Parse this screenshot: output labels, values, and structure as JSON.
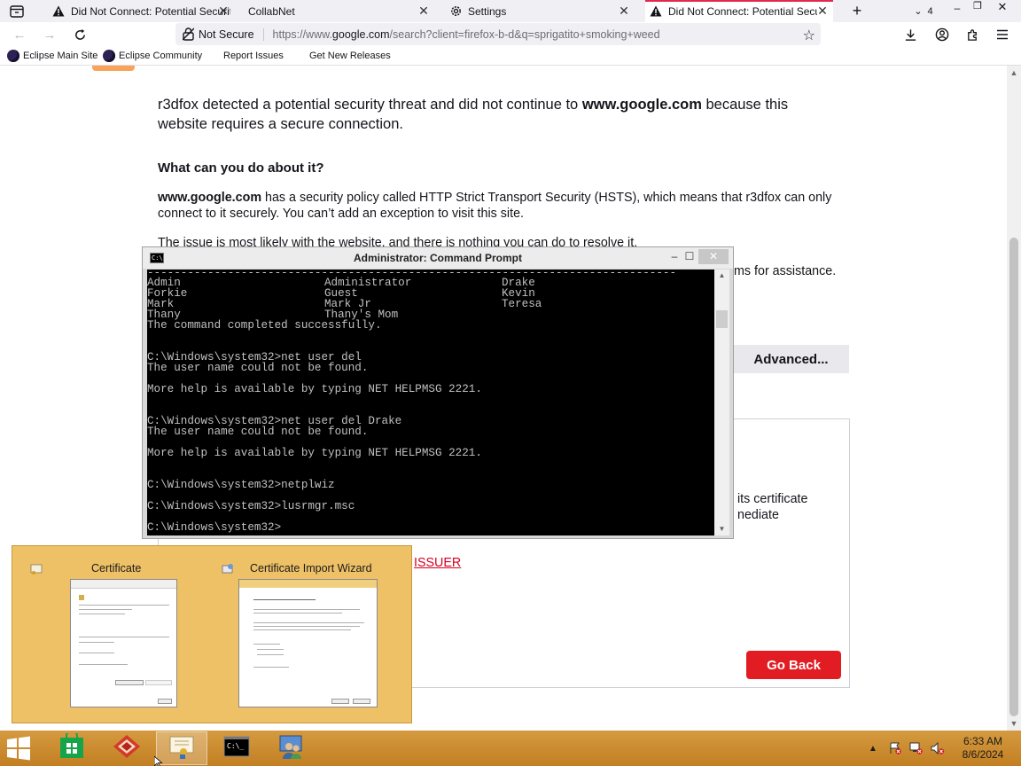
{
  "browser": {
    "tabs": [
      {
        "title": "Did Not Connect: Potential Security Issue",
        "icon": "warning-icon",
        "active": false
      },
      {
        "title": "CollabNet",
        "icon": "",
        "active": false
      },
      {
        "title": "Settings",
        "icon": "gear-icon",
        "active": false
      },
      {
        "title": "Did Not Connect: Potential Security Issue",
        "icon": "warning-icon",
        "active": true
      }
    ],
    "tab_count": "4",
    "security_label": "Not Secure",
    "url_prefix": "https://www.",
    "url_domain": "google.com",
    "url_rest": "/search?client=firefox-b-d&q=sprigatito+smoking+weed",
    "bookmarks": [
      "Eclipse Main Site",
      "Eclipse Community",
      "Report Issues",
      "Get New Releases"
    ]
  },
  "page": {
    "intro_pre": "r3dfox detected a potential security threat and did not continue to ",
    "intro_domain": "www.google.com",
    "intro_post": " because this website requires a secure connection.",
    "what_heading": "What can you do about it?",
    "hsts_domain": "www.google.com",
    "hsts_text": " has a security policy called HTTP Strict Transport Security (HSTS), which means that r3dfox can only connect to it securely. You can’t add an exception to visit this site.",
    "issue_text": "The issue is most likely with the website, and there is nothing you can do to resolve it.",
    "assist_fragment": "ms for assistance.",
    "advanced_label": "Advanced...",
    "adv_fragment_1": "its certificate",
    "adv_fragment_2": "nediate",
    "issuer_link": "ISSUER",
    "go_back_label": "Go Back"
  },
  "cmd": {
    "title": "Administrator: Command Prompt",
    "user_rows": [
      [
        "Admin",
        "Administrator",
        "Drake"
      ],
      [
        "Forkie",
        "Guest",
        "Kevin"
      ],
      [
        "Mark",
        "Mark Jr",
        "Teresa"
      ],
      [
        "Thany",
        "Thany's Mom",
        ""
      ]
    ],
    "lines": [
      "The command completed successfully.",
      "",
      "",
      "C:\\Windows\\system32>net user del",
      "The user name could not be found.",
      "",
      "More help is available by typing NET HELPMSG 2221.",
      "",
      "",
      "C:\\Windows\\system32>net user del Drake",
      "The user name could not be found.",
      "",
      "More help is available by typing NET HELPMSG 2221.",
      "",
      "",
      "C:\\Windows\\system32>netplwiz",
      "",
      "C:\\Windows\\system32>lusrmgr.msc",
      "",
      "C:\\Windows\\system32>"
    ]
  },
  "preview": {
    "items": [
      {
        "title": "Certificate"
      },
      {
        "title": "Certificate Import Wizard"
      }
    ]
  },
  "taskbar": {
    "time": "6:33 AM",
    "date": "8/6/2024",
    "accent": "#c98a2e"
  }
}
